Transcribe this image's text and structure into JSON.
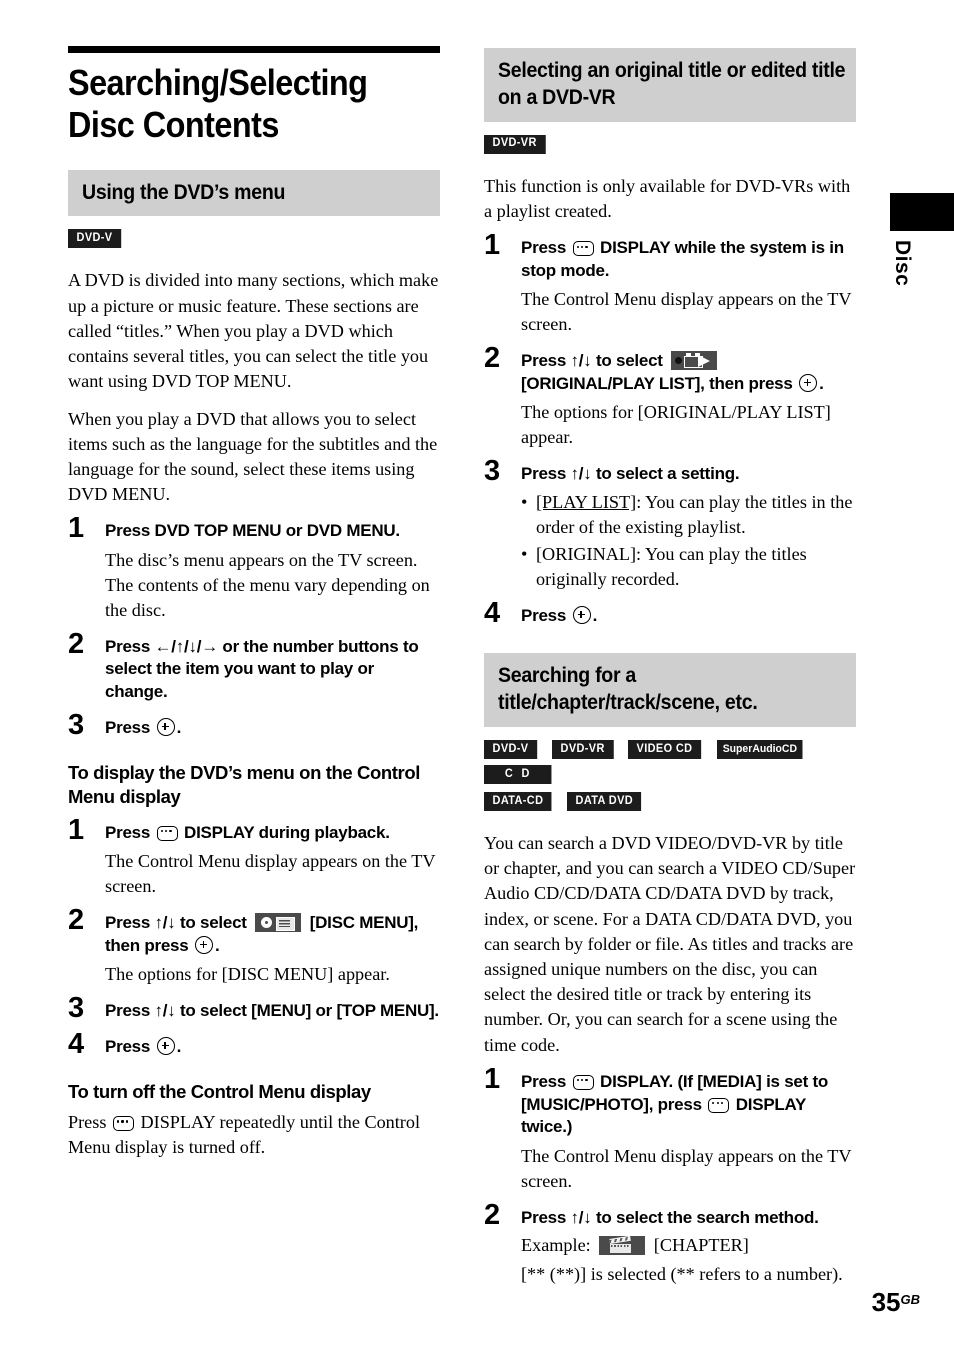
{
  "page": {
    "number": "35",
    "region_code": "GB",
    "thumb_tab_label": "Disc"
  },
  "chapter": {
    "title": "Searching/Selecting Disc Contents"
  },
  "left_column": {
    "section": {
      "heading": "Using the DVD’s menu",
      "badges": [
        "DVD-V"
      ],
      "intro_1": "A DVD is divided into many sections, which make up a picture or music feature. These sections are called “titles.” When you play a DVD which contains several titles, you can select the title you want using DVD TOP MENU.",
      "intro_2": "When you play a DVD that allows you to select items such as the language for the subtitles and the language for the sound, select these items using DVD MENU.",
      "steps": [
        {
          "num": "1",
          "lead": "Press DVD TOP MENU or DVD MENU.",
          "sub": "The disc’s menu appears on the TV screen. The contents of the menu vary depending on the disc."
        },
        {
          "num": "2",
          "lead": "Press ←/↑/↓/→ or the number buttons to select the item you want to play or change."
        },
        {
          "num": "3",
          "lead_prefix": "Press",
          "lead_suffix": "."
        }
      ]
    },
    "subsection_display": {
      "heading": "To display the DVD’s menu on the Control Menu display",
      "steps": [
        {
          "num": "1",
          "lead_prefix": "Press",
          "lead_suffix": "DISPLAY during playback.",
          "sub": "The Control Menu display appears on the TV screen."
        },
        {
          "num": "2",
          "lead_a": "Press ↑/↓ to select",
          "lead_b": "[DISC MENU], then press",
          "lead_c": ".",
          "sub": "The options for [DISC MENU] appear."
        },
        {
          "num": "3",
          "lead": "Press ↑/↓ to select [MENU] or [TOP MENU]."
        },
        {
          "num": "4",
          "lead_prefix": "Press",
          "lead_suffix": "."
        }
      ]
    },
    "subsection_turnoff": {
      "heading": "To turn off the Control Menu display",
      "text_prefix": "Press",
      "text_suffix": "DISPLAY repeatedly until the Control Menu display is turned off."
    }
  },
  "right_column": {
    "section_dvdvr": {
      "heading": "Selecting an original title or edited title on a DVD-VR",
      "badges": [
        "DVD-VR"
      ],
      "intro": "This function is only available for DVD-VRs with a playlist created.",
      "steps": [
        {
          "num": "1",
          "lead_prefix": "Press",
          "lead_suffix": "DISPLAY while the system is in stop mode.",
          "sub": "The Control Menu display appears on the TV screen."
        },
        {
          "num": "2",
          "lead_a": "Press ↑/↓ to select",
          "lead_b": "[ORIGINAL/PLAY LIST], then press",
          "lead_c": ".",
          "sub": "The options for [ORIGINAL/PLAY LIST] appear."
        },
        {
          "num": "3",
          "lead": "Press ↑/↓ to select a setting.",
          "bullets": [
            {
              "label": "[PLAY LIST]",
              "underlined": true,
              "text": ": You can play the titles in the order of the existing playlist."
            },
            {
              "label": "[ORIGINAL]",
              "underlined": false,
              "text": ": You can play the titles originally recorded."
            }
          ]
        },
        {
          "num": "4",
          "lead_prefix": "Press",
          "lead_suffix": "."
        }
      ]
    },
    "section_search": {
      "heading": "Searching for a title/chapter/track/scene, etc.",
      "badges_row1": [
        "DVD-V",
        "DVD-VR",
        "VIDEO CD",
        "SuperAudioCD",
        "C D"
      ],
      "badges_row2": [
        "DATA-CD",
        "DATA DVD"
      ],
      "intro": "You can search a DVD VIDEO/DVD-VR by title or chapter, and you can search a VIDEO CD/Super Audio CD/CD/DATA CD/DATA DVD by track, index, or scene. For a DATA CD/DATA DVD, you can search by folder or file. As titles and tracks are assigned unique numbers on the disc, you can select the desired title or track by entering its number. Or, you can search for a scene using the time code.",
      "steps": [
        {
          "num": "1",
          "lead_a": "Press",
          "lead_b": "DISPLAY. (If [MEDIA] is set to [MUSIC/PHOTO], press",
          "lead_c": "DISPLAY twice.)",
          "sub": "The Control Menu display appears on the TV screen."
        },
        {
          "num": "2",
          "lead": "Press ↑/↓ to select the search method.",
          "example_label": "Example:",
          "example_value": "[CHAPTER]",
          "note": "[** (**)] is selected (** refers to a number)."
        }
      ]
    }
  },
  "icons": {
    "display": "display-button-icon",
    "enter": "enter-button-icon",
    "disc_menu": "disc-menu-icon",
    "original_playlist": "original-playlist-icon",
    "chapter": "chapter-clapperboard-icon"
  },
  "colors": {
    "header_band": "#cfcfcf",
    "badge_bg": "#1c1c1c",
    "icon_badge_bg": "#4a4a4a",
    "rule": "#000000"
  }
}
